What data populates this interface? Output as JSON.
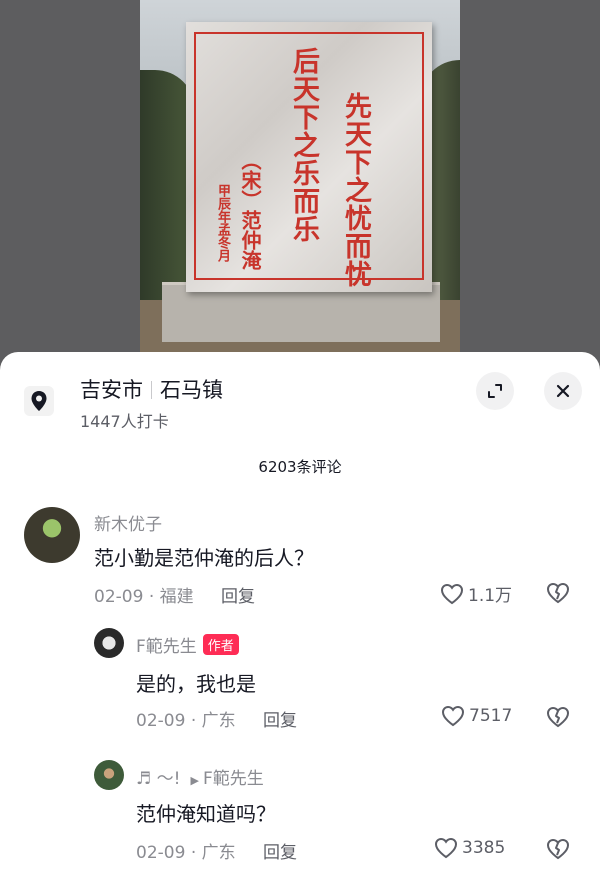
{
  "stele": {
    "column_1": "先天下之忧而忧",
    "column_2": "后天下之乐而乐",
    "column_3": "（宋）范仲淹",
    "column_4": "甲辰年孟冬月"
  },
  "location": {
    "city": "吉安市",
    "town": "石马镇",
    "checkins": "1447人打卡"
  },
  "comments_header": "6203条评论",
  "comments": [
    {
      "user": "新木优子",
      "text": "范小勤是范仲淹的后人？",
      "date": "02-09",
      "region": "福建",
      "reply_label": "回复",
      "likes": "1.1万"
    },
    {
      "user": "F範先生",
      "badge": "作者",
      "text": "是的，我也是",
      "date": "02-09",
      "region": "广东",
      "reply_label": "回复",
      "likes": "7517"
    },
    {
      "user": "♬ ～!",
      "reply_to": "F範先生",
      "text": "范仲淹知道吗？",
      "date": "02-09",
      "region": "广东",
      "reply_label": "回复",
      "likes": "3385"
    }
  ],
  "icons": {
    "location": "map-pin-icon",
    "expand": "expand-icon",
    "close": "close-icon",
    "like": "heart-icon",
    "dislike": "broken-heart-icon"
  },
  "colors": {
    "inscription_red": "#c8342b",
    "author_badge": "#fe2c55",
    "text_primary": "#161823",
    "text_secondary": "#8a8b91"
  }
}
